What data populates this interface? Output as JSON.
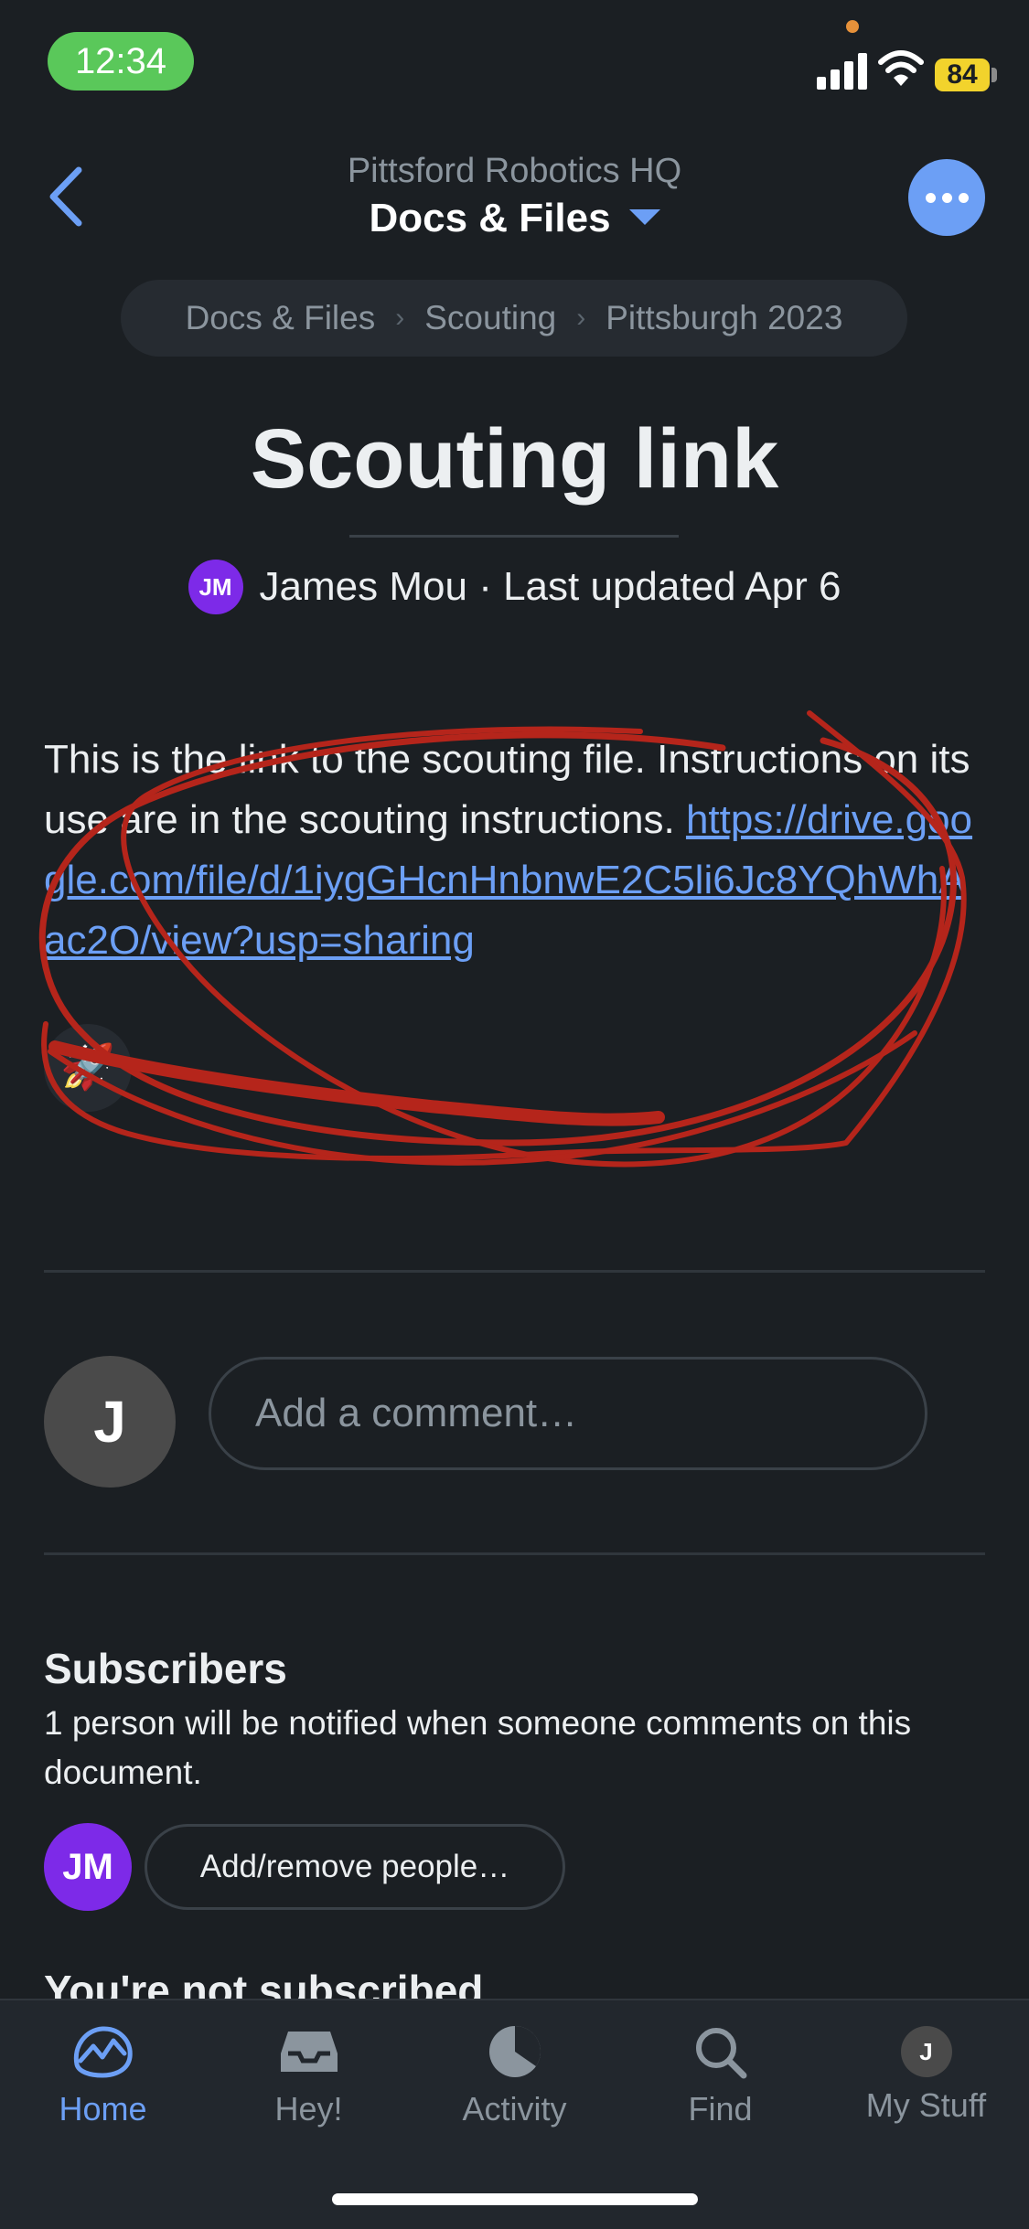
{
  "status_bar": {
    "time": "12:34",
    "battery": "84"
  },
  "header": {
    "subtitle": "Pittsford Robotics HQ",
    "title": "Docs & Files"
  },
  "breadcrumb": [
    {
      "label": "Docs & Files"
    },
    {
      "label": "Scouting"
    },
    {
      "label": "Pittsburgh 2023"
    }
  ],
  "document": {
    "title": "Scouting link",
    "author_initials": "JM",
    "author": "James Mou",
    "updated": "· Last updated Apr 6",
    "body": "This is the link to the scouting file. Instructions on its use are in the scouting instructions.",
    "link": "https://drive.google.com/file/d/1iygGHcnHnbnwE2C5li6Jc8YQhWhAac2O/view?usp=sharing",
    "boost_emoji": "🚀"
  },
  "comment": {
    "avatar_initial": "J",
    "placeholder": "Add a comment…"
  },
  "subscribers": {
    "title": "Subscribers",
    "description": "1 person will be notified when someone comments on this document.",
    "avatar_initials": "JM",
    "button_label": "Add/remove people…",
    "cutoff_heading": "You're not subscribed"
  },
  "tabs": [
    {
      "label": "Home",
      "icon": "home-icon",
      "active": true
    },
    {
      "label": "Hey!",
      "icon": "inbox-icon"
    },
    {
      "label": "Activity",
      "icon": "activity-icon"
    },
    {
      "label": "Find",
      "icon": "search-icon"
    },
    {
      "label": "My Stuff",
      "icon": "avatar",
      "initial": "J"
    }
  ],
  "colors": {
    "background": "#1b1f23",
    "accent": "#6c9ff5",
    "avatar_purple": "#7d2ae8",
    "annotation_red": "#b5251b"
  }
}
